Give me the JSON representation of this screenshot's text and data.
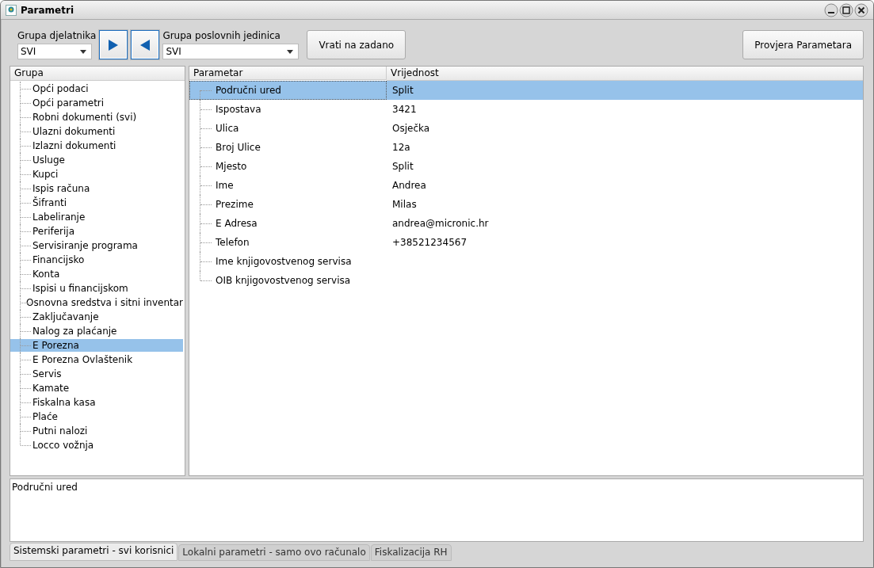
{
  "window": {
    "title": "Parametri"
  },
  "toolbar": {
    "employee_group": {
      "label": "Grupa djelatnika",
      "value": "SVI"
    },
    "business_unit_group": {
      "label": "Grupa poslovnih jedinica",
      "value": "SVI"
    },
    "reset_button": "Vrati na zadano",
    "check_button": "Provjera Parametara"
  },
  "groups": {
    "header": "Grupa",
    "items": [
      {
        "label": "Opći podaci",
        "selected": false
      },
      {
        "label": "Opći parametri",
        "selected": false
      },
      {
        "label": "Robni dokumenti (svi)",
        "selected": false
      },
      {
        "label": "Ulazni dokumenti",
        "selected": false
      },
      {
        "label": "Izlazni dokumenti",
        "selected": false
      },
      {
        "label": "Usluge",
        "selected": false
      },
      {
        "label": "Kupci",
        "selected": false
      },
      {
        "label": "Ispis računa",
        "selected": false
      },
      {
        "label": "Šifranti",
        "selected": false
      },
      {
        "label": "Labeliranje",
        "selected": false
      },
      {
        "label": "Periferija",
        "selected": false
      },
      {
        "label": "Servisiranje programa",
        "selected": false
      },
      {
        "label": "Financijsko",
        "selected": false
      },
      {
        "label": "Konta",
        "selected": false
      },
      {
        "label": "Ispisi u financijskom",
        "selected": false
      },
      {
        "label": "Osnovna sredstva i sitni inventar",
        "selected": false
      },
      {
        "label": "Zaključavanje",
        "selected": false
      },
      {
        "label": "Nalog za plaćanje",
        "selected": false
      },
      {
        "label": "E Porezna",
        "selected": true
      },
      {
        "label": "E Porezna Ovlaštenik",
        "selected": false
      },
      {
        "label": "Servis",
        "selected": false
      },
      {
        "label": "Kamate",
        "selected": false
      },
      {
        "label": "Fiskalna kasa",
        "selected": false
      },
      {
        "label": "Plaće",
        "selected": false
      },
      {
        "label": "Putni nalozi",
        "selected": false
      },
      {
        "label": "Locco vožnja",
        "selected": false
      }
    ]
  },
  "parameters": {
    "columns": [
      "Parametar",
      "Vrijednost"
    ],
    "rows": [
      {
        "name": "Područni ured",
        "value": "Split",
        "selected": true
      },
      {
        "name": "Ispostava",
        "value": "3421",
        "selected": false
      },
      {
        "name": "Ulica",
        "value": "Osječka",
        "selected": false
      },
      {
        "name": "Broj Ulice",
        "value": "12a",
        "selected": false
      },
      {
        "name": "Mjesto",
        "value": "Split",
        "selected": false
      },
      {
        "name": "Ime",
        "value": "Andrea",
        "selected": false
      },
      {
        "name": "Prezime",
        "value": "Milas",
        "selected": false
      },
      {
        "name": "E Adresa",
        "value": "andrea@micronic.hr",
        "selected": false
      },
      {
        "name": "Telefon",
        "value": "+38521234567",
        "selected": false
      },
      {
        "name": "Ime knjigovostvenog servisa",
        "value": "",
        "selected": false
      },
      {
        "name": "OIB knjigovostvenog servisa",
        "value": "",
        "selected": false
      }
    ]
  },
  "description": "Područni ured",
  "tabs": [
    {
      "label": "Sistemski parametri - svi korisnici",
      "selected": true
    },
    {
      "label": "Lokalni parametri - samo ovo računalo",
      "selected": false
    },
    {
      "label": "Fiskalizacija RH",
      "selected": false
    }
  ]
}
